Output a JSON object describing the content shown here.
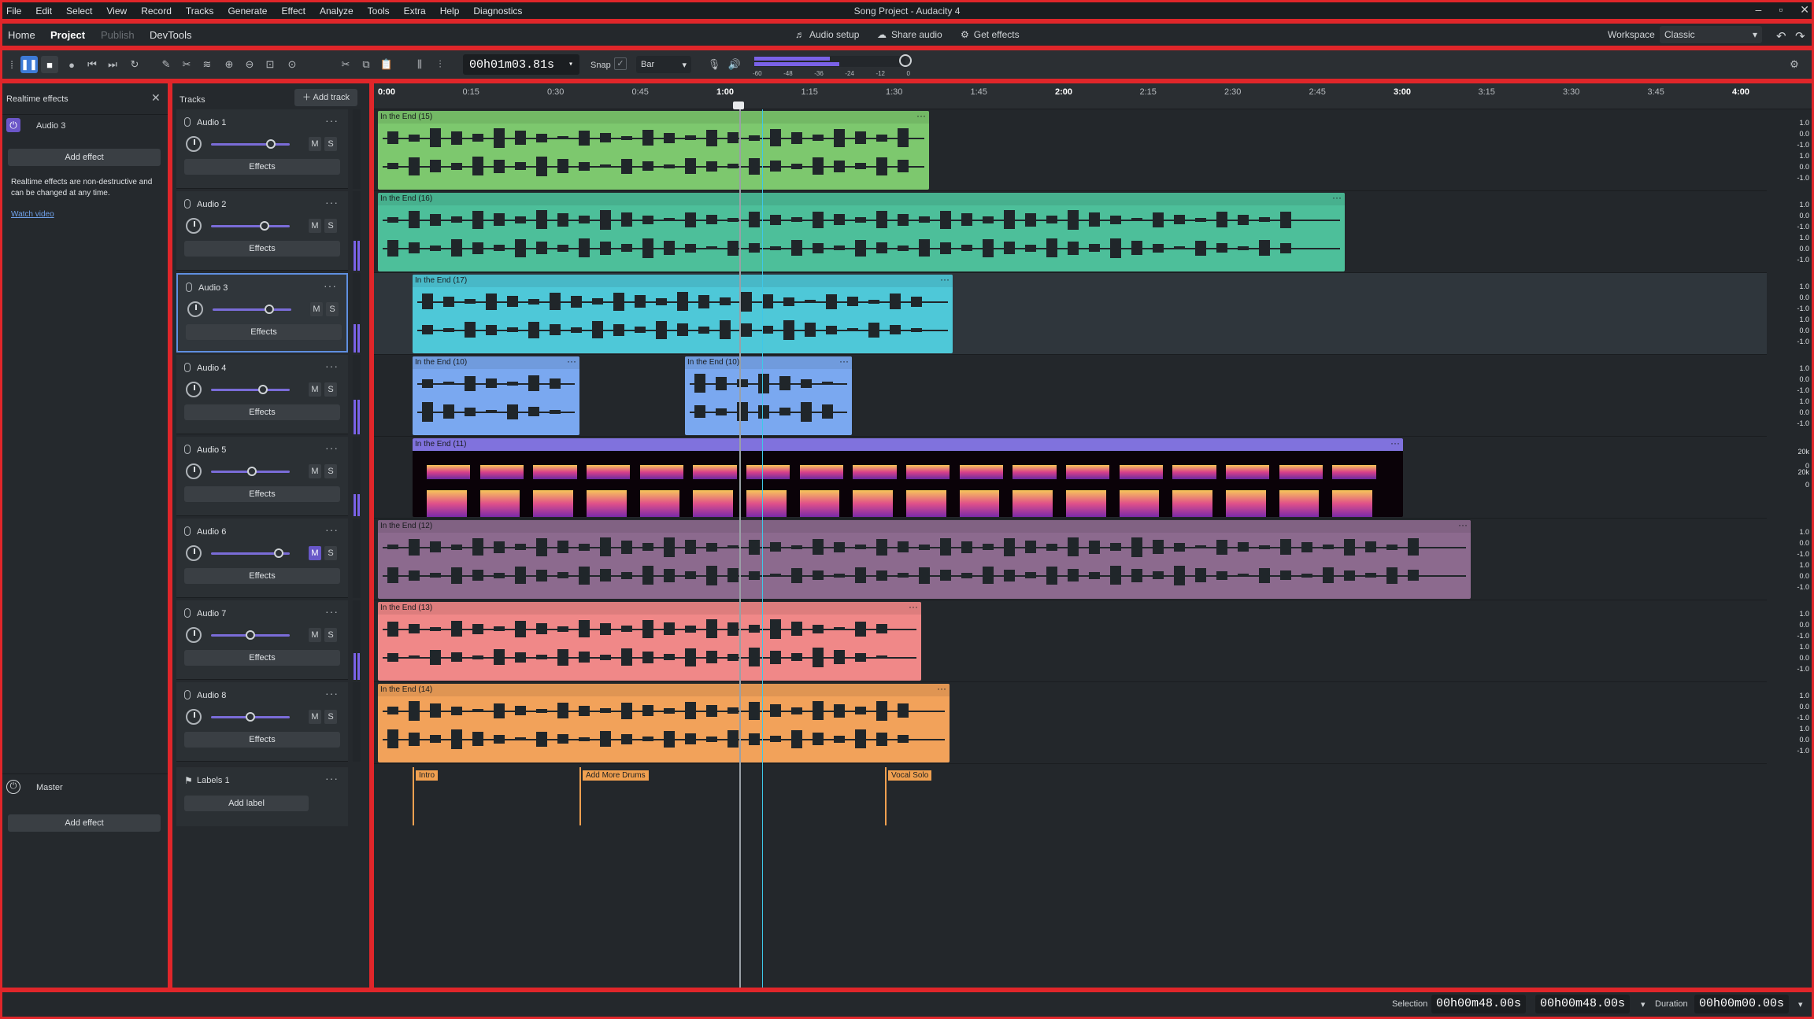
{
  "window": {
    "title": "Song Project - Audacity 4",
    "menu": [
      "File",
      "Edit",
      "Select",
      "View",
      "Record",
      "Tracks",
      "Generate",
      "Effect",
      "Analyze",
      "Tools",
      "Extra",
      "Help",
      "Diagnostics"
    ]
  },
  "project_bar": {
    "tabs": [
      "Home",
      "Project",
      "Publish",
      "DevTools"
    ],
    "active_tab": "Project",
    "audio_setup": "Audio setup",
    "share_audio": "Share audio",
    "get_effects": "Get effects",
    "workspace_label": "Workspace",
    "workspace_value": "Classic"
  },
  "toolbar": {
    "time": "00h01m03.81s",
    "snap_label": "Snap",
    "snap_unit": "Bar",
    "meter_labels": [
      "-60",
      "-48",
      "-36",
      "-24",
      "-12",
      "0"
    ]
  },
  "effects_panel": {
    "title": "Realtime effects",
    "track_name": "Audio 3",
    "add_effect": "Add effect",
    "info": "Realtime effects are non-destructive and can be changed at any time.",
    "watch_video": "Watch video",
    "master_label": "Master",
    "master_add_effect": "Add effect"
  },
  "tracks_panel": {
    "title": "Tracks",
    "add_track": "Add track",
    "effects_label": "Effects",
    "tracks": [
      {
        "name": "Audio 1",
        "mute": "M",
        "solo": "S"
      },
      {
        "name": "Audio 2",
        "mute": "M",
        "solo": "S"
      },
      {
        "name": "Audio 3",
        "mute": "M",
        "solo": "S"
      },
      {
        "name": "Audio 4",
        "mute": "M",
        "solo": "S"
      },
      {
        "name": "Audio 5",
        "mute": "M",
        "solo": "S"
      },
      {
        "name": "Audio 6",
        "mute": "M",
        "solo": "S"
      },
      {
        "name": "Audio 7",
        "mute": "M",
        "solo": "S"
      },
      {
        "name": "Audio 8",
        "mute": "M",
        "solo": "S"
      }
    ],
    "labels_track": "Labels 1",
    "add_label": "Add label"
  },
  "timeline": {
    "ticks": [
      "0:00",
      "0:15",
      "0:30",
      "0:45",
      "1:00",
      "1:15",
      "1:30",
      "1:45",
      "2:00",
      "2:15",
      "2:30",
      "2:45",
      "3:00",
      "3:15",
      "3:30",
      "3:45",
      "4:00"
    ],
    "clips": [
      {
        "name": "In the End (15)",
        "color": "#7dc86e"
      },
      {
        "name": "In the End (16)",
        "color": "#4dbf9a"
      },
      {
        "name": "In the End (17)",
        "color": "#4ec8d8"
      },
      {
        "name": "In the End (10)",
        "color": "#7aa8f0"
      },
      {
        "name": "In the End (10)",
        "color": "#7aa8f0"
      },
      {
        "name": "In the End (11)",
        "color": "#8b7cf0"
      },
      {
        "name": "In the End (12)",
        "color": "#8c6a8e"
      },
      {
        "name": "In the End (13)",
        "color": "#f08888"
      },
      {
        "name": "In the End (14)",
        "color": "#f2a25a"
      }
    ],
    "scale_wave": [
      "1.0",
      "0.0",
      "-1.0",
      "1.0",
      "0.0",
      "-1.0"
    ],
    "scale_spec": [
      "20k",
      "0",
      "20k",
      "0"
    ],
    "labels": [
      "Intro",
      "Add More Drums",
      "Vocal Solo"
    ]
  },
  "status_bar": {
    "selection_label": "Selection",
    "selection_start": "00h00m48.00s",
    "selection_end": "00h00m48.00s",
    "duration_label": "Duration",
    "duration": "00h00m00.00s"
  }
}
